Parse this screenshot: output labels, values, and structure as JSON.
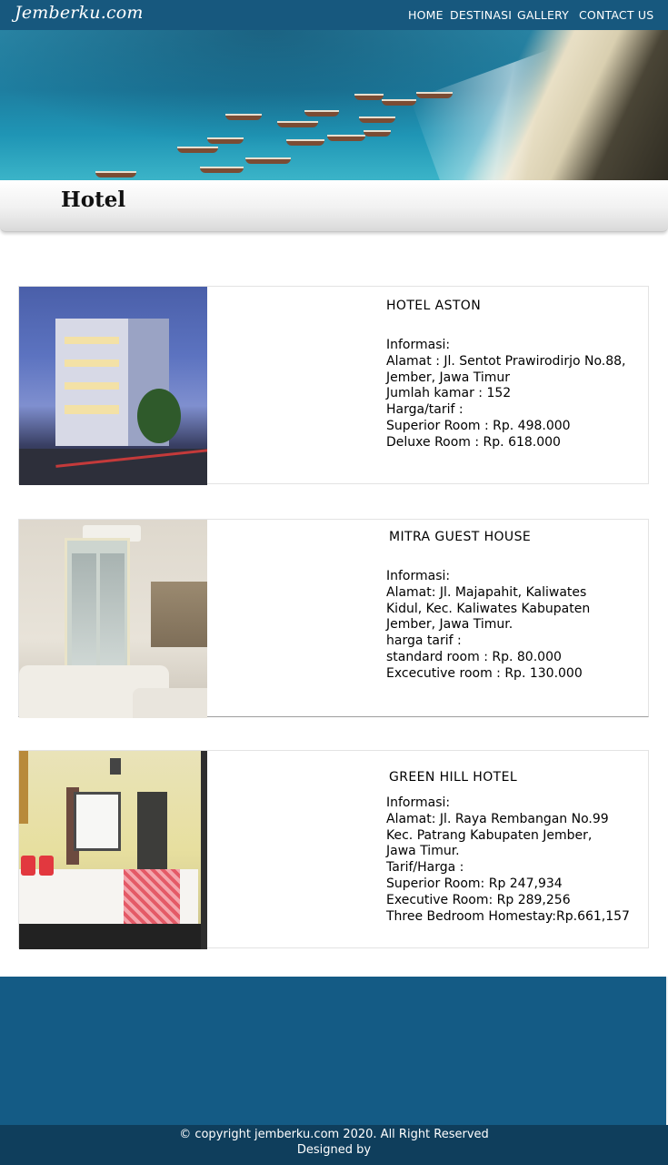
{
  "navbar": {
    "brand": "Jemberku.com",
    "menu": [
      "HOME",
      "DESTINASI",
      "GALLERY",
      "CONTACT US"
    ],
    "background_color": "#17587e"
  },
  "page": {
    "title": "Hotel"
  },
  "hotels": [
    {
      "name": "HOTEL ASTON",
      "info": "Informasi:\nAlamat : Jl. Sentot Prawirodirjo No.88,\nJember, Jawa Timur\nJumlah kamar : 152\nHarga/tarif :\nSuperior Room : Rp. 498.000\nDeluxe Room : Rp. 618.000"
    },
    {
      "name": "MITRA GUEST HOUSE",
      "info": "Informasi:\nAlamat: Jl. Majapahit, Kaliwates\nKidul, Kec. Kaliwates  Kabupaten\nJember, Jawa Timur.\nharga tarif :\nstandard room : Rp. 80.000\nExcecutive room : Rp. 130.000"
    },
    {
      "name": "GREEN HILL HOTEL",
      "info": "Informasi:\nAlamat: Jl. Raya Rembangan No.99\nKec. Patrang  Kabupaten Jember,\nJawa Timur.\nTarif/Harga :\nSuperior Room: Rp 247,934\nExecutive Room: Rp 289,256\nThree Bedroom Homestay:Rp.661,157"
    }
  ],
  "footer": {
    "copyright": "© copyright jemberku.com 2020. All Right Reserved\nDesigned by",
    "background_color": "#145b85"
  }
}
